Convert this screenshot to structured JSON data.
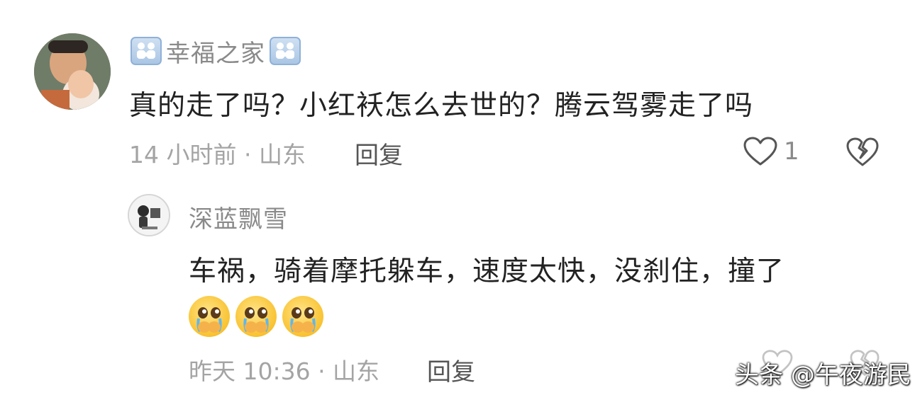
{
  "comment": {
    "username": "幸福之家",
    "text": "真的走了吗？小红袄怎么去世的？腾云驾雾走了吗",
    "meta": "14 小时前 · 山东",
    "reply_label": "回复",
    "like_count": "1",
    "icons": [
      "family-icon",
      "heart-icon",
      "broken-heart-icon"
    ]
  },
  "reply": {
    "username": "深蓝飘雪",
    "text": "车祸，骑着摩托躲车，速度太快，没刹住，撞了",
    "emojis": [
      "crying-face-emoji",
      "crying-face-emoji",
      "crying-face-emoji"
    ],
    "meta": "昨天 10:36 · 山东",
    "reply_label": "回复"
  },
  "watermark": "头条 @午夜游民"
}
